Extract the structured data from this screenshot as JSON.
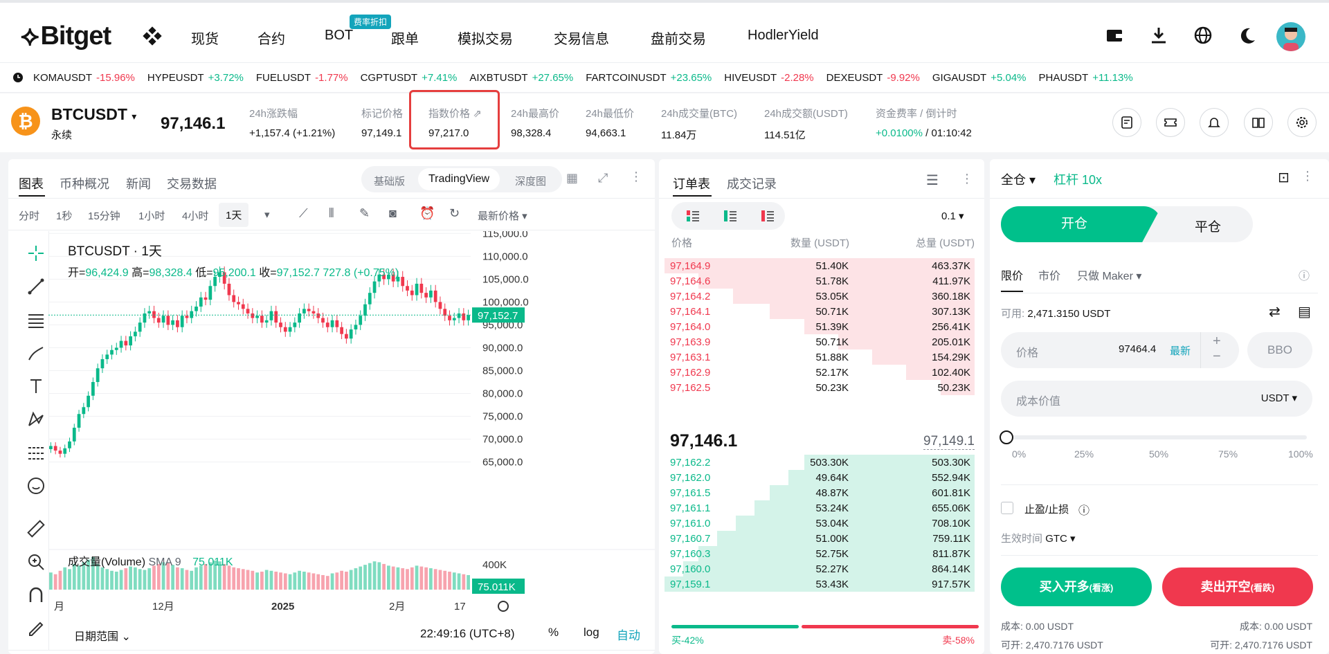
{
  "nav": {
    "logo": "Bitget",
    "items": [
      "现货",
      "合约",
      "BOT",
      "跟单",
      "模拟交易",
      "交易信息",
      "盘前交易",
      "HodlerYield"
    ],
    "badge": "费率折扣"
  },
  "ticker": [
    {
      "s": "KOMAUSDT",
      "c": "-15.96%",
      "up": false
    },
    {
      "s": "HYPEUSDT",
      "c": "+3.72%",
      "up": true
    },
    {
      "s": "FUELUSDT",
      "c": "-1.77%",
      "up": false
    },
    {
      "s": "CGPTUSDT",
      "c": "+7.41%",
      "up": true
    },
    {
      "s": "AIXBTUSDT",
      "c": "+27.65%",
      "up": true
    },
    {
      "s": "FARTCOINUSDT",
      "c": "+23.65%",
      "up": true
    },
    {
      "s": "HIVEUSDT",
      "c": "-2.28%",
      "up": false
    },
    {
      "s": "DEXEUSDT",
      "c": "-9.92%",
      "up": false
    },
    {
      "s": "GIGAUSDT",
      "c": "+5.04%",
      "up": true
    },
    {
      "s": "PHAUSDT",
      "c": "+11.13%",
      "up": true
    }
  ],
  "info": {
    "symbol": "BTCUSDT",
    "type": "永续",
    "last": "97,146.1",
    "change_label": "24h涨跌幅",
    "change_value": "+1,157.4 (+1.21%)",
    "mark_label": "标记价格",
    "mark_value": "97,149.1",
    "index_label": "指数价格",
    "index_value": "97,217.0",
    "high_label": "24h最高价",
    "high_value": "98,328.4",
    "low_label": "24h最低价",
    "low_value": "94,663.1",
    "vol_btc_label": "24h成交量(BTC)",
    "vol_btc_value": "11.84万",
    "vol_usdt_label": "24h成交额(USDT)",
    "vol_usdt_value": "114.51亿",
    "funding_label": "资金费率 / 倒计时",
    "funding_rate": "+0.0100%",
    "funding_countdown": "/ 01:10:42"
  },
  "chart_panel": {
    "tabs": [
      "图表",
      "币种概况",
      "新闻",
      "交易数据"
    ],
    "seg": [
      "基础版",
      "TradingView",
      "深度图"
    ],
    "intervals": [
      "分时",
      "1秒",
      "15分钟",
      "1小时",
      "4小时",
      "1天"
    ],
    "price_type": "最新价格",
    "legend_title": "BTCUSDT · 1天",
    "ohlc": {
      "o_label": "开=",
      "o": "96,424.9",
      "h_label": "高=",
      "h": "98,328.4",
      "l_label": "低=",
      "l": "95,200.1",
      "c_label": "收=",
      "c": "97,152.7",
      "chg": "727.8 (+0.75%)"
    },
    "vol_label": "成交量(Volume)",
    "vol_sma": "SMA 9",
    "vol_value": "75.011K",
    "vol_axis": "400K",
    "last_tag": "97,152.7",
    "date_range": "日期范围",
    "clock": "22:49:16 (UTC+8)",
    "pct": "%",
    "log": "log",
    "auto": "自动"
  },
  "chart_data": {
    "type": "candlestick",
    "title": "BTCUSDT · 1天",
    "y_ticks": [
      "115,000.0",
      "110,000.0",
      "105,000.0",
      "100,000.0",
      "95,000.0",
      "90,000.0",
      "85,000.0",
      "80,000.0",
      "75,000.0",
      "70,000.0",
      "65,000.0"
    ],
    "x_ticks": [
      "月",
      "12月",
      "2025",
      "2月",
      "17"
    ],
    "ylim": [
      61000,
      115500
    ],
    "close": [
      68500,
      67500,
      66800,
      68000,
      69500,
      72500,
      75500,
      77000,
      79500,
      82500,
      85500,
      87500,
      88500,
      89500,
      90000,
      91500,
      90500,
      92500,
      93500,
      95500,
      97500,
      98000,
      96500,
      95500,
      97000,
      95000,
      96000,
      94500,
      97000,
      96500,
      98000,
      99000,
      101000,
      100500,
      103500,
      105500,
      106500,
      104000,
      101500,
      100000,
      99500,
      98500,
      97500,
      96500,
      97000,
      95500,
      96000,
      98000,
      95500,
      94500,
      93500,
      94500,
      95500,
      97500,
      98500,
      98000,
      97500,
      96500,
      95500,
      94500,
      96000,
      94500,
      93000,
      92000,
      94000,
      95000,
      97000,
      99500,
      102000,
      104500,
      106000,
      105000,
      106000,
      104500,
      105500,
      103500,
      102500,
      101500,
      104000,
      102000,
      101000,
      102500,
      100000,
      98500,
      97000,
      96000,
      96500,
      97500,
      96000,
      97152.7
    ],
    "volume": [
      200,
      180,
      220,
      260,
      240,
      300,
      280,
      320,
      350,
      380,
      300,
      260,
      240,
      220,
      210,
      230,
      250,
      270,
      260,
      240,
      230,
      250,
      280,
      300,
      320,
      310,
      290,
      260,
      250,
      230,
      220,
      260,
      280,
      300,
      320,
      340,
      330,
      300,
      280,
      260,
      250,
      240,
      230,
      220,
      200,
      210,
      230,
      220,
      210,
      200,
      190,
      180,
      200,
      220,
      210,
      200,
      190,
      180,
      170,
      160,
      190,
      200,
      220,
      210,
      230,
      250,
      270,
      290,
      310,
      330,
      320,
      300,
      280,
      270,
      260,
      250,
      240,
      260,
      280,
      270,
      260,
      250,
      240,
      230,
      220,
      210,
      200,
      190,
      180,
      170
    ]
  },
  "orderbook": {
    "tabs": [
      "订单表",
      "成交记录"
    ],
    "precision": "0.1",
    "headers": [
      "价格",
      "数量 (USDT)",
      "总量 (USDT)"
    ],
    "asks": [
      {
        "p": "97,164.9",
        "q": "51.40K",
        "t": "463.37K",
        "d": 1.0
      },
      {
        "p": "97,164.6",
        "q": "51.78K",
        "t": "411.97K",
        "d": 0.89
      },
      {
        "p": "97,164.2",
        "q": "53.05K",
        "t": "360.18K",
        "d": 0.78
      },
      {
        "p": "97,164.1",
        "q": "50.71K",
        "t": "307.13K",
        "d": 0.66
      },
      {
        "p": "97,164.0",
        "q": "51.39K",
        "t": "256.41K",
        "d": 0.55
      },
      {
        "p": "97,163.9",
        "q": "50.71K",
        "t": "205.01K",
        "d": 0.44
      },
      {
        "p": "97,163.1",
        "q": "51.88K",
        "t": "154.29K",
        "d": 0.33
      },
      {
        "p": "97,162.9",
        "q": "52.17K",
        "t": "102.40K",
        "d": 0.22
      },
      {
        "p": "97,162.5",
        "q": "50.23K",
        "t": "50.23K",
        "d": 0.11
      }
    ],
    "mid": "97,146.1",
    "mark": "97,149.1",
    "bids": [
      {
        "p": "97,162.2",
        "q": "503.30K",
        "t": "503.30K",
        "d": 0.55
      },
      {
        "p": "97,162.0",
        "q": "49.64K",
        "t": "552.94K",
        "d": 0.6
      },
      {
        "p": "97,161.5",
        "q": "48.87K",
        "t": "601.81K",
        "d": 0.66
      },
      {
        "p": "97,161.1",
        "q": "53.24K",
        "t": "655.06K",
        "d": 0.71
      },
      {
        "p": "97,161.0",
        "q": "53.04K",
        "t": "708.10K",
        "d": 0.77
      },
      {
        "p": "97,160.7",
        "q": "51.00K",
        "t": "759.11K",
        "d": 0.83
      },
      {
        "p": "97,160.3",
        "q": "52.75K",
        "t": "811.87K",
        "d": 0.89
      },
      {
        "p": "97,160.0",
        "q": "52.27K",
        "t": "864.14K",
        "d": 0.94
      },
      {
        "p": "97,159.1",
        "q": "53.43K",
        "t": "917.57K",
        "d": 1.0
      }
    ],
    "buy_pct": "买-42%",
    "sell_pct": "卖-58%",
    "buy_ratio": 0.42
  },
  "order_panel": {
    "margin_mode": "全仓",
    "leverage": "杠杆 10x",
    "open": "开仓",
    "close": "平仓",
    "types": [
      "限价",
      "市价",
      "只做 Maker"
    ],
    "avail_label": "可用:",
    "avail_value": "2,471.3150 USDT",
    "price_label": "价格",
    "price_value": "97464.4",
    "price_latest": "最新",
    "bbo": "BBO",
    "cost_label": "成本价值",
    "cost_unit": "USDT",
    "slider": [
      "0%",
      "25%",
      "50%",
      "75%",
      "100%"
    ],
    "slider_value": 0,
    "tpsl": "止盈/止损",
    "tif_label": "生效时间",
    "tif_value": "GTC",
    "buy": "买入开多",
    "buy_sub": "(看涨)",
    "sell": "卖出开空",
    "sell_sub": "(看跌)",
    "cost_left": "成本: 0.00 USDT",
    "avail_left": "可开: 2,470.7176 USDT",
    "cost_right": "成本: 0.00 USDT",
    "avail_right": "可开: 2,470.7176 USDT"
  },
  "colors": {
    "up": "#0ab98a",
    "down": "#f0384e",
    "accent": "#00c08b"
  }
}
